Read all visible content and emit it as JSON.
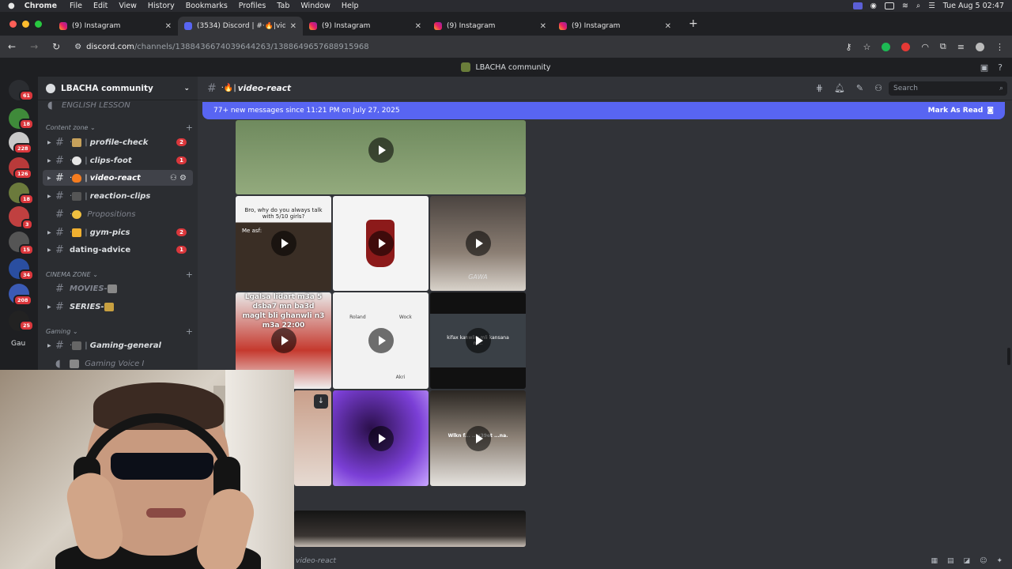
{
  "menubar": {
    "app": "Chrome",
    "menus": [
      "File",
      "Edit",
      "View",
      "History",
      "Bookmarks",
      "Profiles",
      "Tab",
      "Window",
      "Help"
    ],
    "clock": "Tue Aug 5  02:47"
  },
  "tabs": [
    {
      "title": "(9) Instagram",
      "icon": "instagram-icon"
    },
    {
      "title": "(3534) Discord | #·🔥|video-r",
      "icon": "discord-icon"
    },
    {
      "title": "(9) Instagram",
      "icon": "instagram-icon"
    },
    {
      "title": "(9) Instagram",
      "icon": "instagram-icon"
    },
    {
      "title": "(9) Instagram",
      "icon": "instagram-icon"
    }
  ],
  "address": {
    "host": "discord.com",
    "path": "/channels/1388436674039644263/1388649657688915968"
  },
  "title_bar": {
    "server_name": "LBACHA community"
  },
  "rail": {
    "home_badge": "61",
    "servers": [
      {
        "badge": "18",
        "color": "#3f8a3a"
      },
      {
        "badge": "228",
        "color": "#c9c9c9"
      },
      {
        "badge": "126",
        "color": "#b93a3a"
      },
      {
        "badge": "18",
        "color": "#6b7a3c"
      },
      {
        "badge": "3",
        "color": "#c04040"
      },
      {
        "badge": "15",
        "color": "#555"
      },
      {
        "badge": "34",
        "color": "#2a4ea0"
      },
      {
        "badge": "208",
        "color": "#3b5bb5"
      },
      {
        "badge": "25",
        "color": "#222"
      }
    ],
    "text_server": "Gau"
  },
  "sidebar": {
    "guild_name": "LBACHA community",
    "top_cut": "ENGLISH LESSON",
    "categories": [
      {
        "name": "Content zone",
        "channels": [
          {
            "name": "profile-check",
            "prefix": "·",
            "sep": "|",
            "badge": "2",
            "emoji_color": "#c6a15b"
          },
          {
            "name": "clips-foot",
            "prefix": "·",
            "sep": "|",
            "badge": "1",
            "emoji_color": "#e6e6e6"
          },
          {
            "name": "video-react",
            "prefix": "·",
            "sep": "|",
            "badge": "",
            "emoji_color": "#f57c1f",
            "selected": true
          },
          {
            "name": "reaction-clips",
            "prefix": "·",
            "sep": "|",
            "badge": "",
            "emoji_color": "#555"
          },
          {
            "name": "Propositions",
            "prefix": "·",
            "sep": "",
            "badge": "",
            "emoji_color": "#f0c040",
            "dim": true
          },
          {
            "name": "gym-pics",
            "prefix": "·",
            "sep": "|",
            "badge": "2",
            "emoji_color": "#f0b030"
          },
          {
            "name": "dating-advice",
            "prefix": "",
            "sep": "",
            "badge": "1",
            "emoji_color": "",
            "plain": true
          }
        ]
      },
      {
        "name": "CINEMA ZONE",
        "channels": [
          {
            "name": "MOVIES-",
            "prefix": "",
            "sep": "",
            "badge": "",
            "emoji_color": "#888",
            "dim": true
          },
          {
            "name": "SERIES-",
            "prefix": "",
            "sep": "",
            "badge": "",
            "emoji_color": "#c8a040"
          }
        ]
      },
      {
        "name": "Gaming",
        "channels": [
          {
            "name": "Gaming-general",
            "prefix": "·",
            "sep": "|",
            "badge": "",
            "emoji_color": "#666"
          },
          {
            "name": "Gaming Voice I",
            "prefix": "",
            "sep": "",
            "badge": "",
            "emoji_color": "#888",
            "dim": true,
            "voice": true
          }
        ]
      }
    ]
  },
  "channel_header": {
    "prefix": "·🔥|",
    "name": "video-react",
    "search_placeholder": "Search"
  },
  "new_messages": {
    "text": "77+ new messages since 11:21 PM on July 27, 2025",
    "action": "Mark As Read"
  },
  "media": {
    "tile1_caption": "Bro, why do you always talk with 5/10 girls?",
    "tile1_sub": "Me asf:",
    "tile4_caption": "Lgalsa lidart m3a 5 dsba7 mn ba3d maglt bli ghanwli n3 m3a 22:00",
    "tile5_labels": [
      "Roland",
      "Wock",
      "Akri"
    ],
    "tile6_caption": "kifax kanwliw mli kansana m...",
    "tile9_caption": "Wlkn f... ...y39et ...na.",
    "tile3_watermark": "GAWA"
  },
  "footer": {
    "channel": "video-react"
  }
}
